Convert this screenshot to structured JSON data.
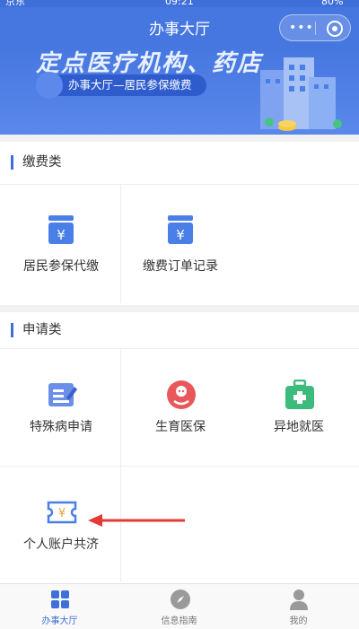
{
  "status_bar": {
    "carrier": "京东",
    "time": "09:21",
    "battery": "80%"
  },
  "nav": {
    "title": "办事大厅"
  },
  "banner": {
    "headline": "定点医疗机构、药店",
    "pill_text": "办事大厅—居民参保缴费"
  },
  "sections": [
    {
      "title": "缴费类",
      "items": [
        {
          "label": "居民参保代缴",
          "icon": "yuan-calendar-icon"
        },
        {
          "label": "缴费订单记录",
          "icon": "yuan-calendar-icon"
        }
      ]
    },
    {
      "title": "申请类",
      "items": [
        {
          "label": "特殊病申请",
          "icon": "edit-document-icon"
        },
        {
          "label": "生育医保",
          "icon": "baby-icon"
        },
        {
          "label": "异地就医",
          "icon": "medical-kit-icon"
        },
        {
          "label": "个人账户共济",
          "icon": "yuan-ticket-icon"
        }
      ]
    }
  ],
  "tabbar": {
    "items": [
      {
        "label": "办事大厅",
        "icon": "grid-icon",
        "active": true
      },
      {
        "label": "信息指南",
        "icon": "compass-icon",
        "active": false
      },
      {
        "label": "我的",
        "icon": "person-icon",
        "active": false
      }
    ]
  },
  "colors": {
    "primary": "#4677e0",
    "icon_blue": "#4a7fe8",
    "icon_red": "#e8585b",
    "icon_green": "#3dbb7d",
    "annotation_arrow": "#e53935"
  }
}
